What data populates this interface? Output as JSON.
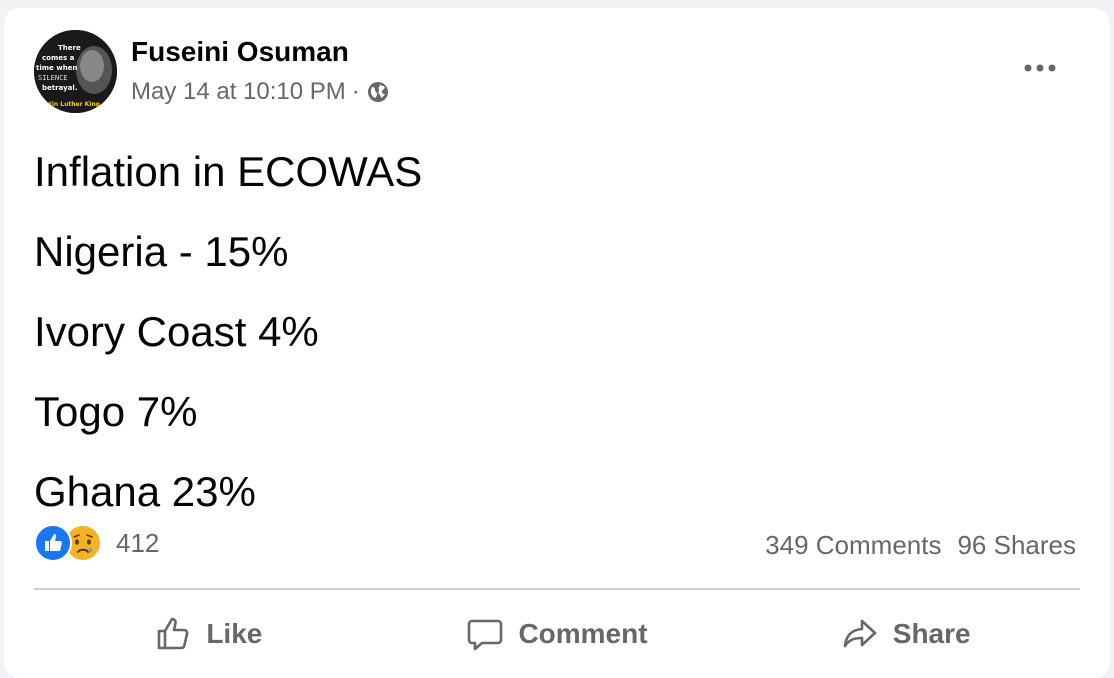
{
  "post": {
    "author": "Fuseini Osuman",
    "timestamp": "May 14 at 10:10 PM",
    "separator": "·",
    "privacy_icon": "globe-icon",
    "avatar_text": [
      "There",
      "comes a",
      "time when",
      "SILENCE",
      "betrayal.",
      "Martin Luther King"
    ],
    "lines": [
      "Inflation in ECOWAS",
      "Nigeria - 15%",
      "Ivory Coast 4%",
      "Togo 7%",
      "Ghana 23%"
    ]
  },
  "stats": {
    "reaction_icons": [
      "like-icon",
      "sad-icon"
    ],
    "reaction_count": "412",
    "comments": "349 Comments",
    "shares": "96 Shares"
  },
  "actions": {
    "like": "Like",
    "comment": "Comment",
    "share": "Share"
  },
  "colors": {
    "brand_blue": "#1877f2",
    "secondary_text": "#65676b",
    "sad_yellow": "#f7b125"
  }
}
